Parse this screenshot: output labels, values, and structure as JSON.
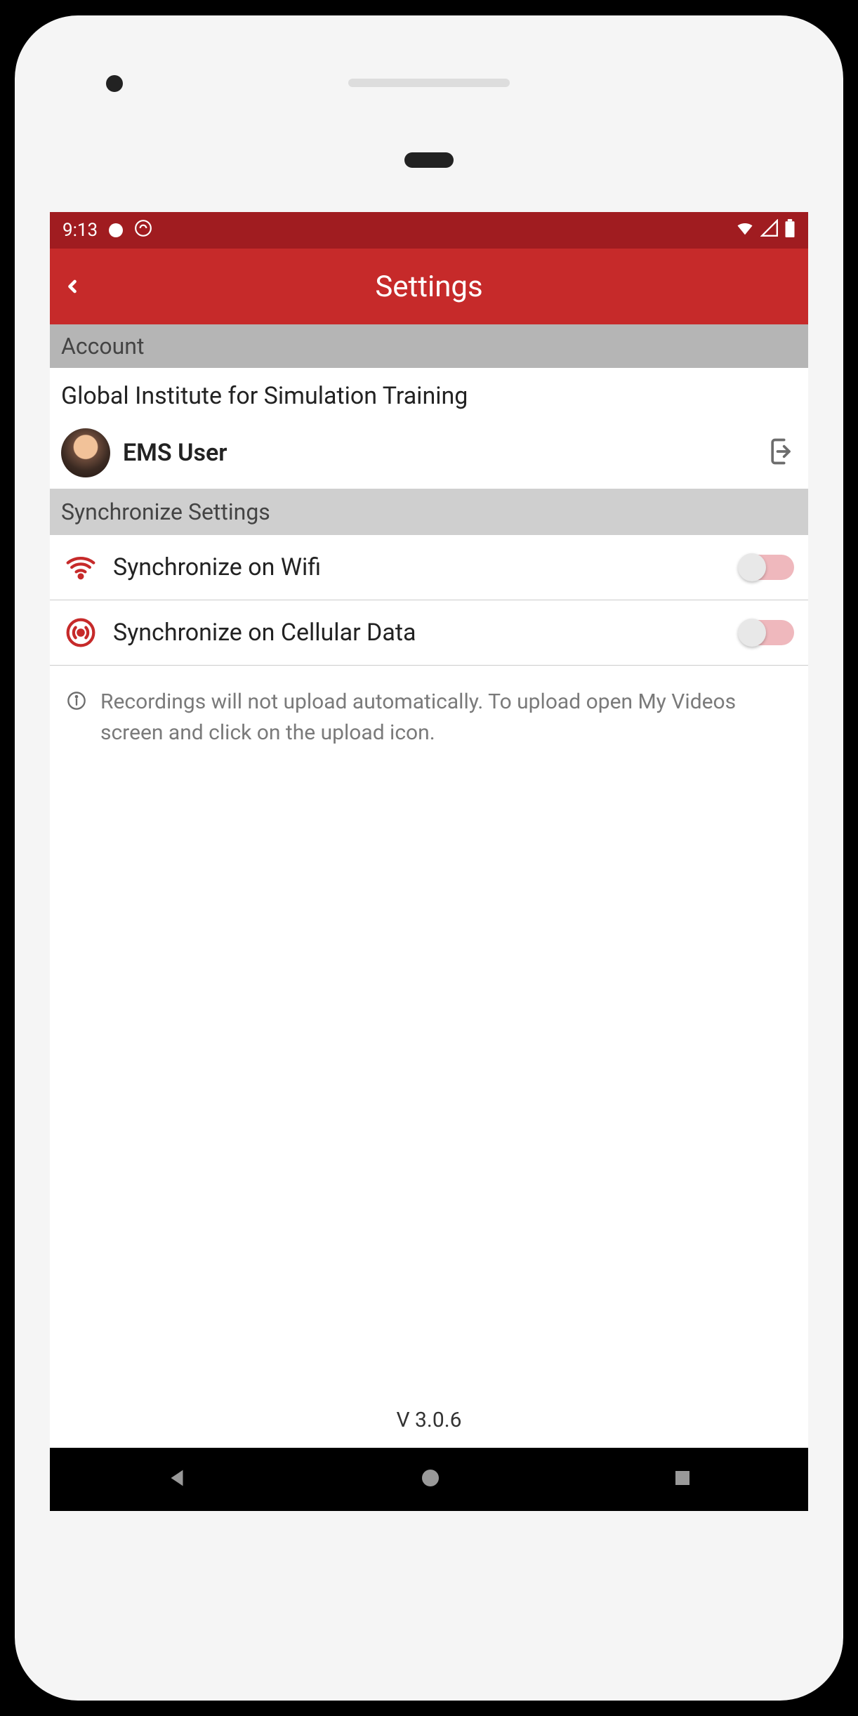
{
  "status": {
    "time": "9:13"
  },
  "header": {
    "title": "Settings"
  },
  "sections": {
    "account": {
      "header": "Account",
      "org": "Global Institute for Simulation Training",
      "user": "EMS User"
    },
    "sync": {
      "header": "Synchronize Settings",
      "wifi_label": "Synchronize on Wifi",
      "cellular_label": "Synchronize on Cellular Data",
      "wifi_on": false,
      "cellular_on": false,
      "info": "Recordings will not upload automatically. To upload open My Videos screen and click on the upload icon."
    }
  },
  "footer": {
    "version": "V 3.0.6"
  },
  "colors": {
    "primary": "#c62a2a",
    "primary_dark": "#a01c20",
    "toggle_off_track": "#efb8bd"
  }
}
